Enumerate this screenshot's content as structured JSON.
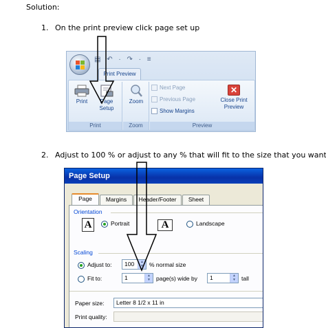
{
  "doc": {
    "heading": "Solution:",
    "steps": [
      {
        "num": "1.",
        "text": "On the print preview click page set up"
      },
      {
        "num": "2.",
        "text": "Adjust to 100 % or adjust to any % that will fit to the size that you want"
      }
    ]
  },
  "ribbon": {
    "qat": "▤ ↶ · ↷ · ≡",
    "tab": "Print Preview",
    "groups": [
      {
        "label": "Print",
        "buttons": [
          "Print",
          "Page Setup"
        ]
      },
      {
        "label": "Zoom",
        "buttons": [
          "Zoom"
        ]
      },
      {
        "label": "Preview",
        "buttons": [
          "Next Page",
          "Previous Page",
          "Show Margins",
          "Close Print Preview"
        ]
      }
    ],
    "colors": {
      "accent": "#15428b",
      "close": "#d9433a"
    }
  },
  "dialog": {
    "title": "Page Setup",
    "tabs": [
      "Page",
      "Margins",
      "Header/Footer",
      "Sheet"
    ],
    "orientation": {
      "section": "Orientation",
      "portrait": "Portrait",
      "landscape": "Landscape",
      "icon_letter": "A",
      "selected": "Portrait"
    },
    "scaling": {
      "section": "Scaling",
      "adjust_label": "Adjust to:",
      "adjust_value": "100",
      "adjust_suffix": "% normal size",
      "fit_label": "Fit to:",
      "fit_wide": "1",
      "fit_mid": "page(s) wide by",
      "fit_tall": "1",
      "fit_suffix": "tall",
      "selected": "Adjust to:"
    },
    "paper_size": {
      "label": "Paper size:",
      "value": "Letter 8 1/2 x 11 in"
    },
    "print_quality": {
      "label": "Print quality:",
      "value": ""
    }
  }
}
